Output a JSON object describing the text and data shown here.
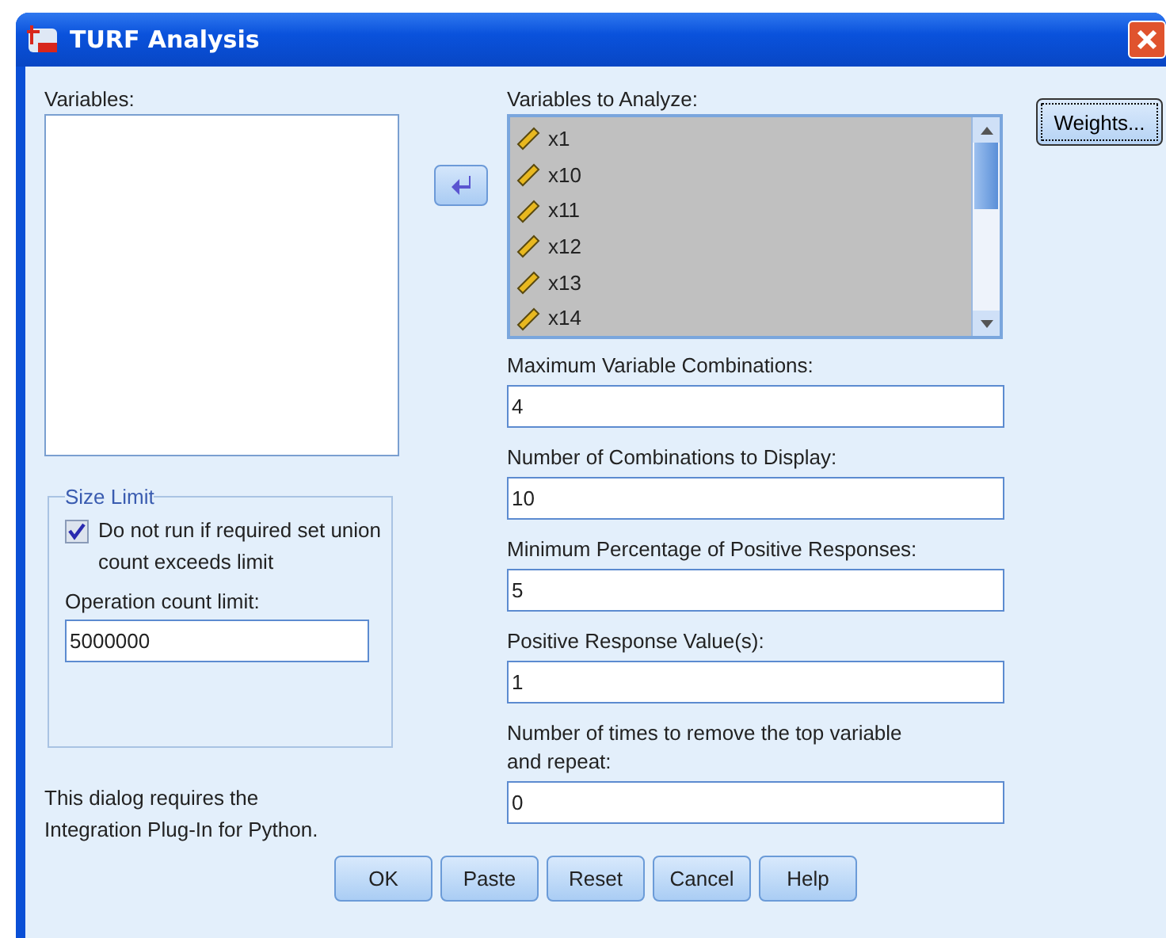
{
  "window": {
    "title": "TURF Analysis"
  },
  "variables": {
    "label": "Variables:"
  },
  "analyze": {
    "label": "Variables to Analyze:",
    "items": [
      "x1",
      "x10",
      "x11",
      "x12",
      "x13",
      "x14"
    ]
  },
  "weights_button": "Weights...",
  "size_limit": {
    "title": "Size Limit",
    "checkbox": {
      "label": "Do not run if required set union count exceeds limit",
      "checked": true
    },
    "limit_label": "Operation count limit:",
    "limit_value": "5000000"
  },
  "fields": [
    {
      "label": "Maximum Variable Combinations:",
      "value": "4"
    },
    {
      "label": "Number of Combinations to Display:",
      "value": "10"
    },
    {
      "label": "Minimum Percentage of Positive Responses:",
      "value": "5"
    },
    {
      "label": "Positive Response Value(s):",
      "value": "1"
    },
    {
      "label": "Number of times to remove the top variable and repeat:",
      "value": "0"
    }
  ],
  "note": "This dialog requires the Integration Plug-In for Python.",
  "buttons": [
    "OK",
    "Paste",
    "Reset",
    "Cancel",
    "Help"
  ]
}
